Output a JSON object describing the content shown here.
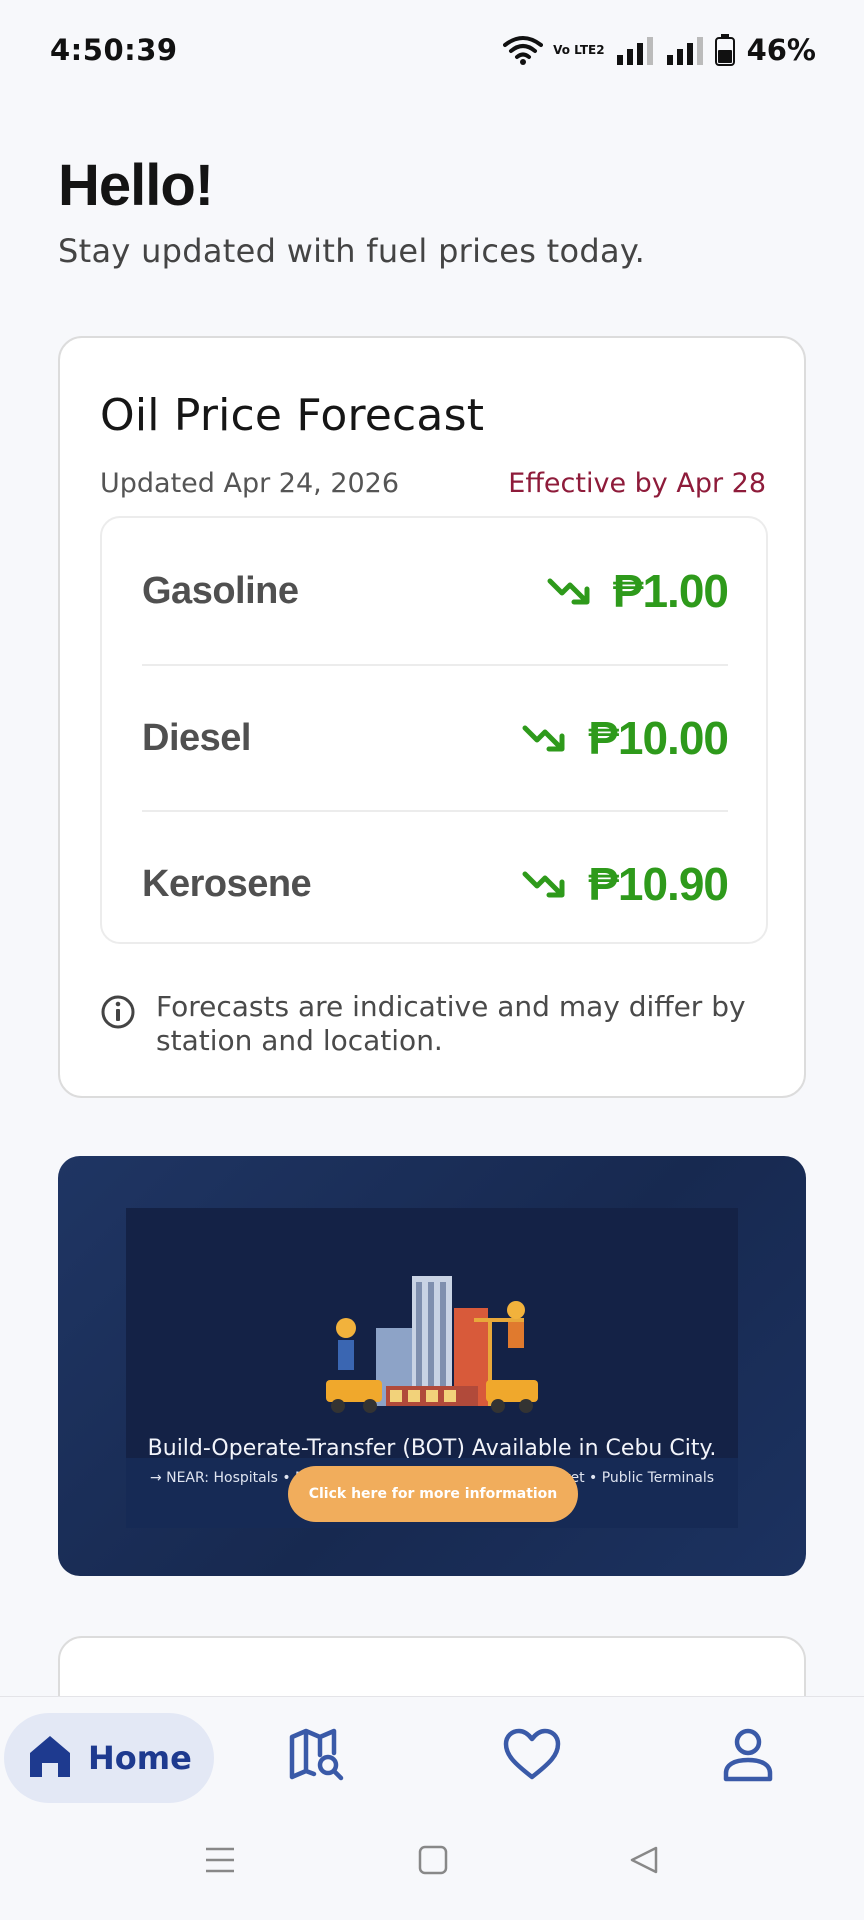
{
  "status_bar": {
    "time": "4:50:39",
    "network": "Vo LTE2",
    "battery": "46%"
  },
  "greeting": {
    "title": "Hello!",
    "subtitle": "Stay updated with fuel prices today."
  },
  "forecast": {
    "title": "Oil Price Forecast",
    "updated": "Updated Apr 24, 2026",
    "effective": "Effective by Apr 28",
    "items": [
      {
        "name": "Gasoline",
        "price": "₱1.00",
        "trend": "down"
      },
      {
        "name": "Diesel",
        "price": "₱10.00",
        "trend": "down"
      },
      {
        "name": "Kerosene",
        "price": "₱10.90",
        "trend": "down"
      }
    ],
    "disclaimer": "Forecasts are indicative and may differ by station and location."
  },
  "banner": {
    "title": "Build-Operate-Transfer (BOT) Available in Cebu City.",
    "near": "→ NEAR: Hospitals • Malls • Major Universities • Public Market • Public Terminals",
    "cta": "Click here for more information"
  },
  "bottom_nav": {
    "home_label": "Home",
    "items": [
      "home-icon",
      "map-search-icon",
      "heart-icon",
      "profile-icon"
    ]
  },
  "colors": {
    "accent": "#1e3a8f",
    "price_down": "#2e9a1b",
    "effective": "#8e1b3a",
    "cta": "#f1ad5c"
  }
}
